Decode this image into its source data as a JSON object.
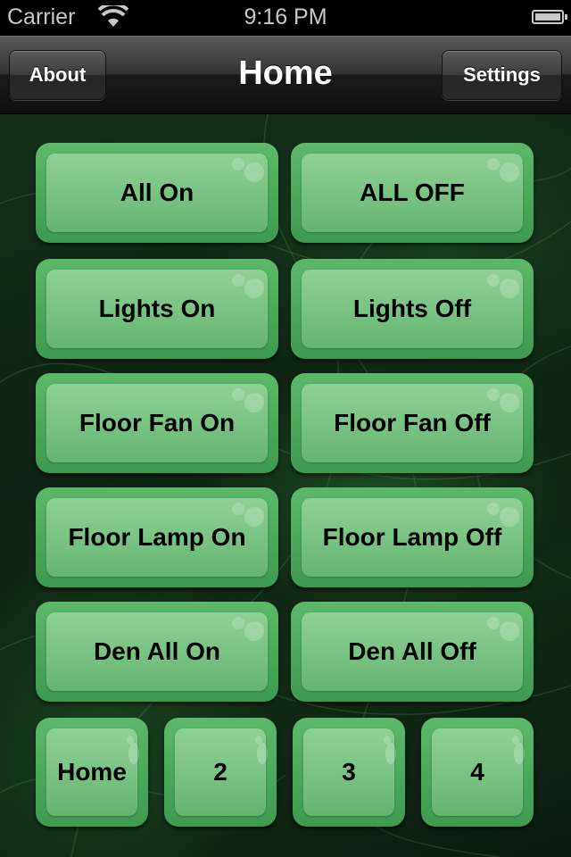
{
  "status_bar": {
    "carrier": "Carrier",
    "time": "9:16 PM",
    "wifi_icon": "wifi-icon",
    "battery_icon": "battery-icon"
  },
  "navbar": {
    "title": "Home",
    "left_button": "About",
    "right_button": "Settings"
  },
  "buttons": [
    {
      "label": "All On"
    },
    {
      "label": "ALL OFF"
    },
    {
      "label": "Lights On"
    },
    {
      "label": "Lights Off"
    },
    {
      "label": "Floor Fan On"
    },
    {
      "label": "Floor Fan Off"
    },
    {
      "label": "Floor Lamp On"
    },
    {
      "label": "Floor Lamp Off"
    },
    {
      "label": "Den All On"
    },
    {
      "label": "Den All Off"
    }
  ],
  "pages": [
    {
      "label": "Home"
    },
    {
      "label": "2"
    },
    {
      "label": "3"
    },
    {
      "label": "4"
    }
  ]
}
